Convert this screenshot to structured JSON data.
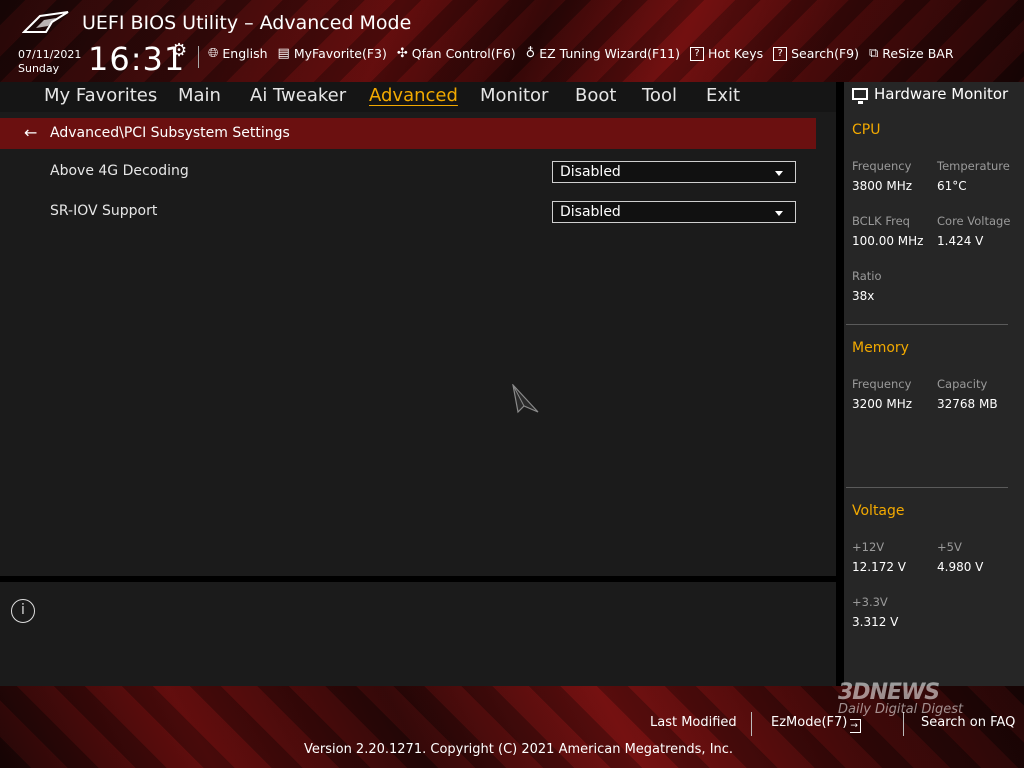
{
  "header": {
    "title": "UEFI BIOS Utility – Advanced Mode",
    "date": "07/11/2021",
    "day": "Sunday",
    "time": "16:31"
  },
  "toolbar": [
    {
      "icon": "globe-icon",
      "label": "English"
    },
    {
      "icon": "favorite-list-icon",
      "label": "MyFavorite(F3)"
    },
    {
      "icon": "fan-icon",
      "label": "Qfan Control(F6)"
    },
    {
      "icon": "bulb-icon",
      "label": "EZ Tuning Wizard(F11)"
    },
    {
      "icon": "help-box-icon",
      "label": "Hot Keys"
    },
    {
      "icon": "help-box-icon",
      "label": "Search(F9)"
    },
    {
      "icon": "resize-bar-icon",
      "label": "ReSize BAR"
    }
  ],
  "nav": {
    "items": [
      "My Favorites",
      "Main",
      "Ai Tweaker",
      "Advanced",
      "Monitor",
      "Boot",
      "Tool",
      "Exit"
    ],
    "active": "Advanced"
  },
  "breadcrumb": "Advanced\\PCI Subsystem Settings",
  "settings": [
    {
      "label": "Above 4G Decoding",
      "value": "Disabled"
    },
    {
      "label": "SR-IOV Support",
      "value": "Disabled"
    }
  ],
  "hw": {
    "title": "Hardware Monitor",
    "cpu": {
      "title": "CPU",
      "frequency_label": "Frequency",
      "frequency": "3800 MHz",
      "temperature_label": "Temperature",
      "temperature": "61°C",
      "bclk_label": "BCLK Freq",
      "bclk": "100.00 MHz",
      "core_voltage_label": "Core Voltage",
      "core_voltage": "1.424 V",
      "ratio_label": "Ratio",
      "ratio": "38x"
    },
    "memory": {
      "title": "Memory",
      "frequency_label": "Frequency",
      "frequency": "3200 MHz",
      "capacity_label": "Capacity",
      "capacity": "32768 MB"
    },
    "voltage": {
      "title": "Voltage",
      "v12_label": "+12V",
      "v12": "12.172 V",
      "v5_label": "+5V",
      "v5": "4.980 V",
      "v33_label": "+3.3V",
      "v33": "3.312 V"
    }
  },
  "footer": {
    "last_modified": "Last Modified",
    "ezmode": "EzMode(F7)",
    "search_faq": "Search on FAQ",
    "copyright": "Version 2.20.1271. Copyright (C) 2021 American Megatrends, Inc."
  },
  "watermark": {
    "big": "3D",
    "news": "NEWS",
    "sub": "Daily Digital Digest"
  }
}
